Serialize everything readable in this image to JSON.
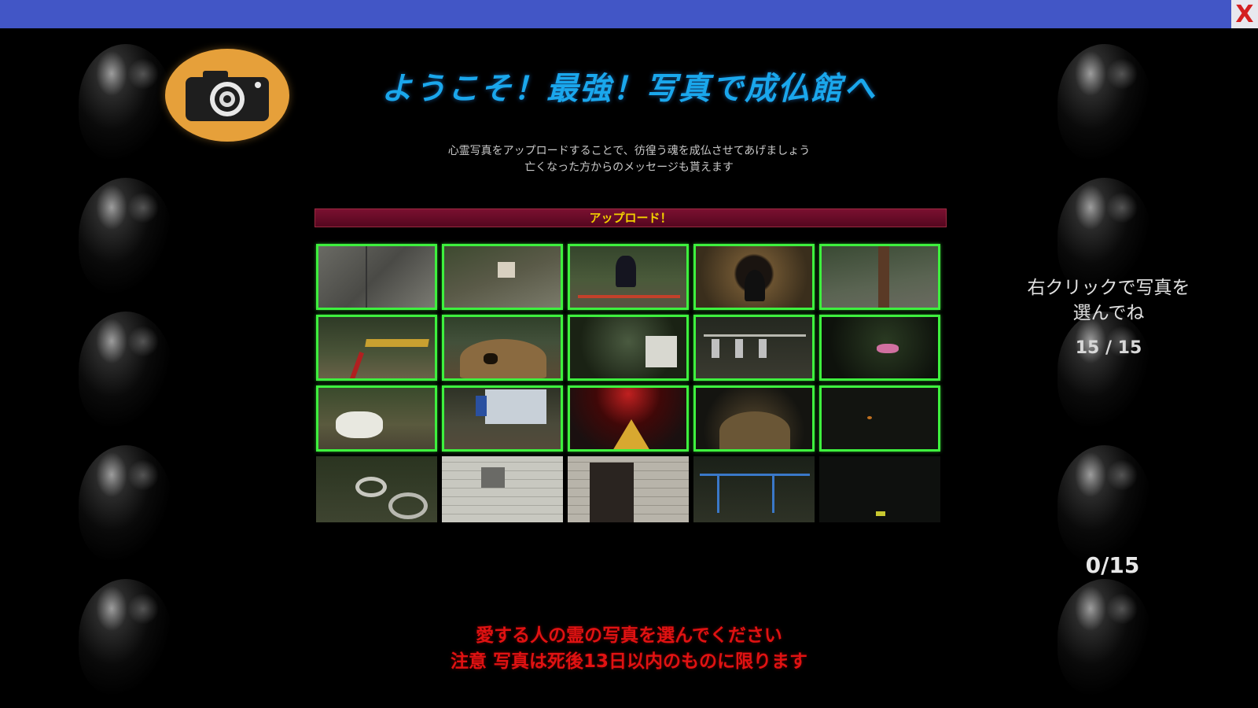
{
  "window": {
    "close_label": "X"
  },
  "header": {
    "logo_icon": "camera-icon",
    "title": "ようこそ！最強！写真で成仏館へ",
    "description_line1": "心霊写真をアップロードすることで、彷徨う魂を成仏させてあげましょう",
    "description_line2": "亡くなった方からのメッセージも貰えます"
  },
  "upload": {
    "label": "アップロード！"
  },
  "photos": [
    {
      "name": "concrete-wall",
      "selected": true
    },
    {
      "name": "tree-with-sign",
      "selected": true
    },
    {
      "name": "girl-in-playground",
      "selected": true
    },
    {
      "name": "dome-tunnel",
      "selected": true
    },
    {
      "name": "tree-trunk-park",
      "selected": true
    },
    {
      "name": "red-slide",
      "selected": true
    },
    {
      "name": "dome-playhouse",
      "selected": true
    },
    {
      "name": "mailbox-night",
      "selected": true
    },
    {
      "name": "hanging-dolls",
      "selected": true
    },
    {
      "name": "pink-swing",
      "selected": true
    },
    {
      "name": "rabbit-figure",
      "selected": true
    },
    {
      "name": "vending-machine",
      "selected": true
    },
    {
      "name": "red-light-figure",
      "selected": true
    },
    {
      "name": "dome-night",
      "selected": true
    },
    {
      "name": "dark-field",
      "selected": true
    },
    {
      "name": "tires",
      "selected": false
    },
    {
      "name": "tiled-sink",
      "selected": false
    },
    {
      "name": "toilet-door",
      "selected": false
    },
    {
      "name": "jungle-gym",
      "selected": false
    },
    {
      "name": "dark-night",
      "selected": false
    }
  ],
  "side_panel": {
    "instruction_line1": "右クリックで写真を",
    "instruction_line2": "選んでね",
    "count": "15 / 15"
  },
  "counter": {
    "value": "0/15"
  },
  "warning": {
    "line1": "愛する人の霊の写真を選んでください",
    "line2": "注意 写真は死後13日以内のものに限ります"
  },
  "colors": {
    "titlebar": "#4256c6",
    "title": "#1aa7ec",
    "upload_bar": "#7a1030",
    "upload_text": "#f2d000",
    "selected_border": "#3ef03e",
    "warning": "#e01212",
    "logo": "#e6a03a"
  }
}
